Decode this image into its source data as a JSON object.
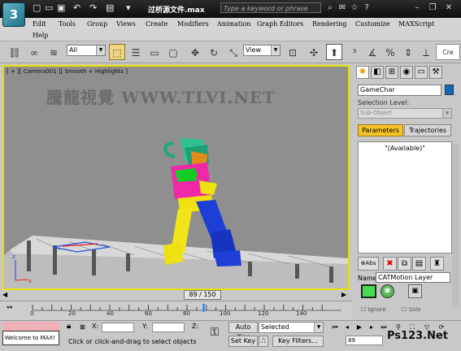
{
  "title_bar": {
    "app_logo": "3",
    "title": "过桥源文件.max",
    "search_placeholder": "Type a keyword or phrase"
  },
  "menu": {
    "items": [
      "Edit",
      "Tools",
      "Group",
      "Views",
      "Create",
      "Modifiers",
      "Animation",
      "Graph Editors",
      "Rendering",
      "Customize",
      "MAXScript",
      "Help"
    ]
  },
  "toolbar": {
    "selection_filter": "All",
    "reference_coord": "View"
  },
  "viewport": {
    "label": "[ + ][ Camera001 ][ Smooth + Highlights ]",
    "watermark": "騰龍視覺 WWW.TLVI.NET"
  },
  "command_panel": {
    "object_name": "GameChar",
    "object_color": "#1565c0",
    "selection_level_label": "Selection Level:",
    "sub_object_placeholder": "Sub-Object",
    "tabs": [
      "Parameters",
      "Trajectories"
    ],
    "active_tab": "Parameters",
    "list_items": [
      "\"(Available)\""
    ],
    "abs_label": "Abs",
    "name_label": "Name:",
    "name_value": "CATMotion Layer",
    "ignore_label": "Ignore",
    "solo_label": "Solo"
  },
  "timeline": {
    "current_frame": "89 / 150",
    "ticks": [
      "0",
      "20",
      "40",
      "60",
      "80",
      "100",
      "120",
      "140"
    ]
  },
  "status_bar": {
    "welcome": "Welcome to MAX!",
    "x_label": "X:",
    "y_label": "Y:",
    "z_label": "Z:",
    "prompt": "Click or click-and-drag to select objects",
    "auto_key_label": "Auto Key",
    "selected_value": "Selected",
    "set_key_label": "Set Key",
    "key_filters_label": "Key Filters...",
    "frame_value": "89"
  },
  "watermark_logo": "Ps123.Net"
}
